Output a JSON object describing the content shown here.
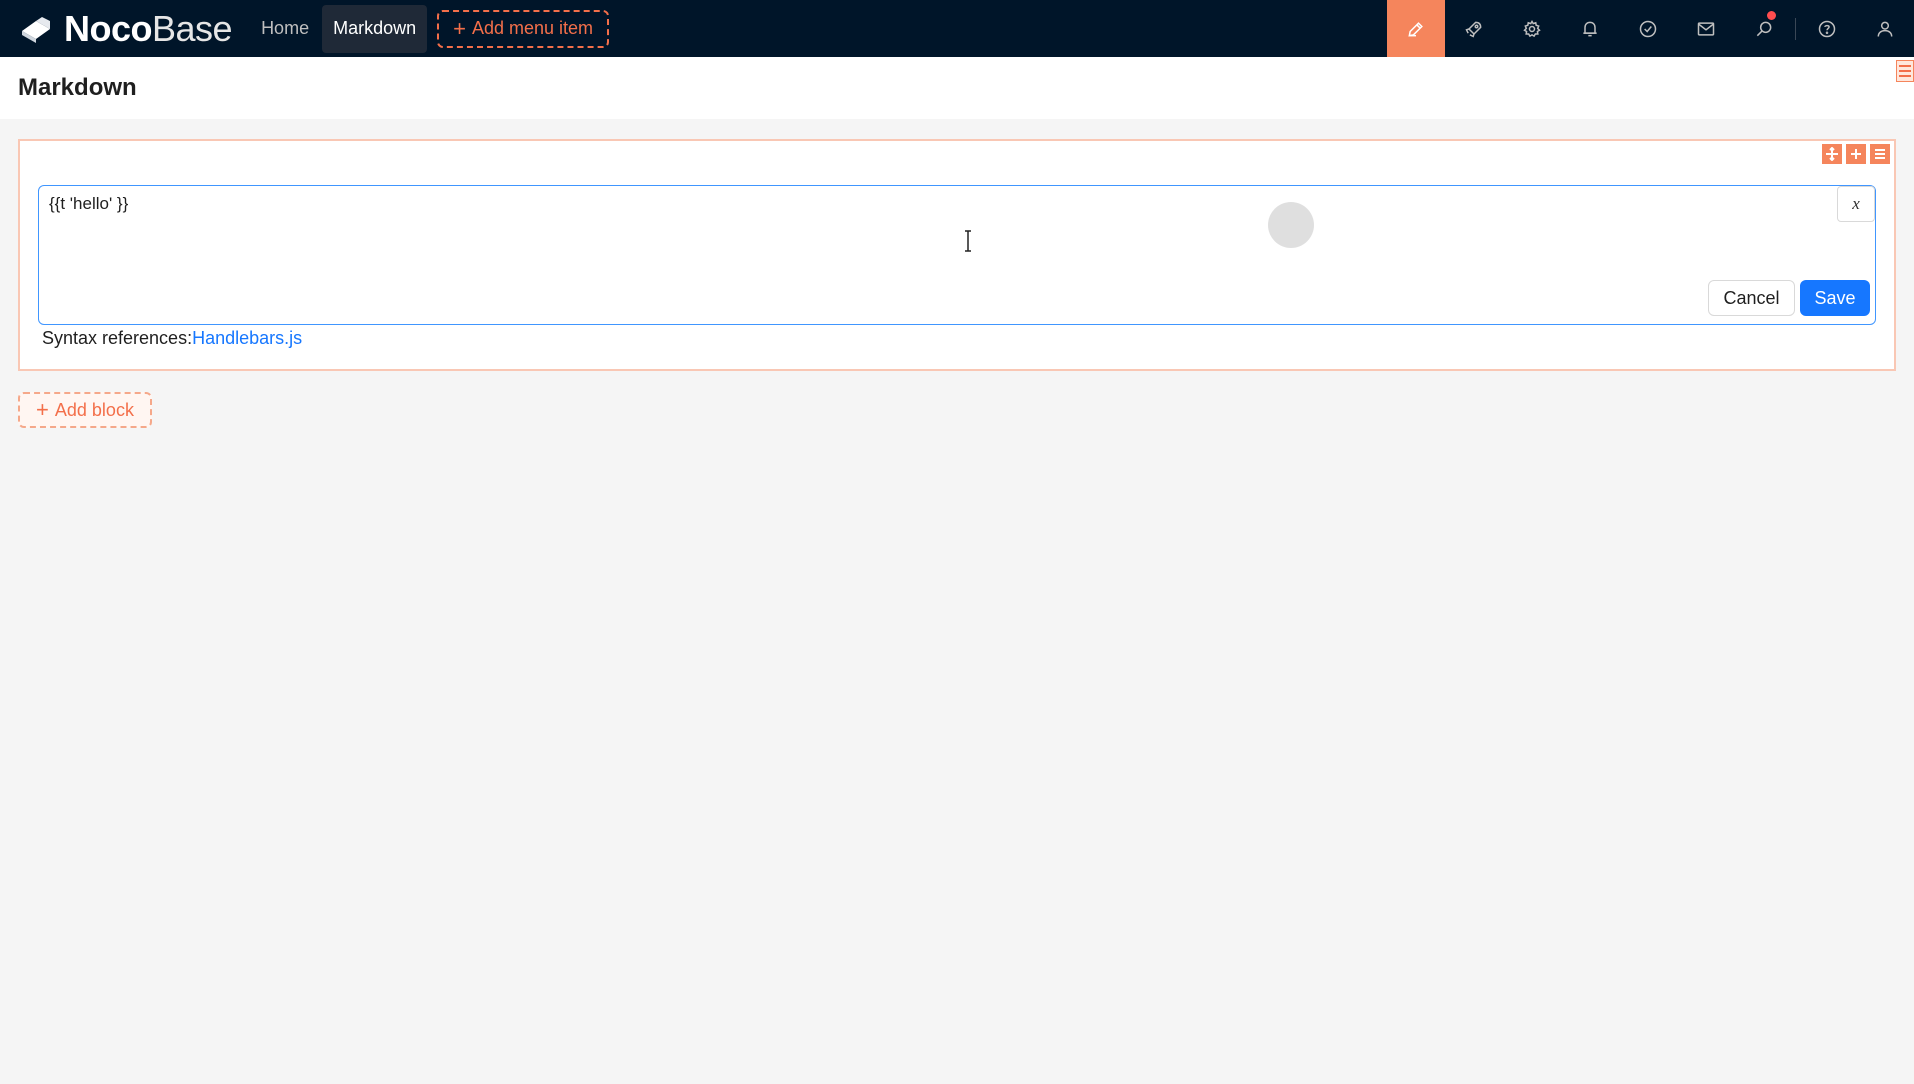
{
  "app": {
    "logo_bold": "Noco",
    "logo_thin": "Base"
  },
  "nav": {
    "items": [
      {
        "label": "Home"
      },
      {
        "label": "Markdown"
      }
    ],
    "add_menu_item": "Add menu item"
  },
  "top_icons": [
    {
      "icon": "ui-editor-icon",
      "active": true
    },
    {
      "icon": "plugin-rocket-icon"
    },
    {
      "icon": "settings-gear-icon"
    },
    {
      "icon": "notification-bell-icon"
    },
    {
      "icon": "task-check-icon"
    },
    {
      "icon": "mail-icon"
    },
    {
      "icon": "search-key-icon",
      "badge": true
    },
    {
      "icon": "help-icon"
    },
    {
      "icon": "user-icon"
    }
  ],
  "page": {
    "title": "Markdown"
  },
  "markdown_block": {
    "editor_value": "{{t 'hello' }}",
    "variable_button": "x",
    "cancel_label": "Cancel",
    "save_label": "Save",
    "syntax_prefix": "Syntax references:",
    "syntax_link": "Handlebars.js"
  },
  "add_block": {
    "label": "Add block"
  },
  "colors": {
    "topbar_bg": "#001529",
    "accent_orange": "#f5855c",
    "primary_blue": "#1677ff"
  }
}
